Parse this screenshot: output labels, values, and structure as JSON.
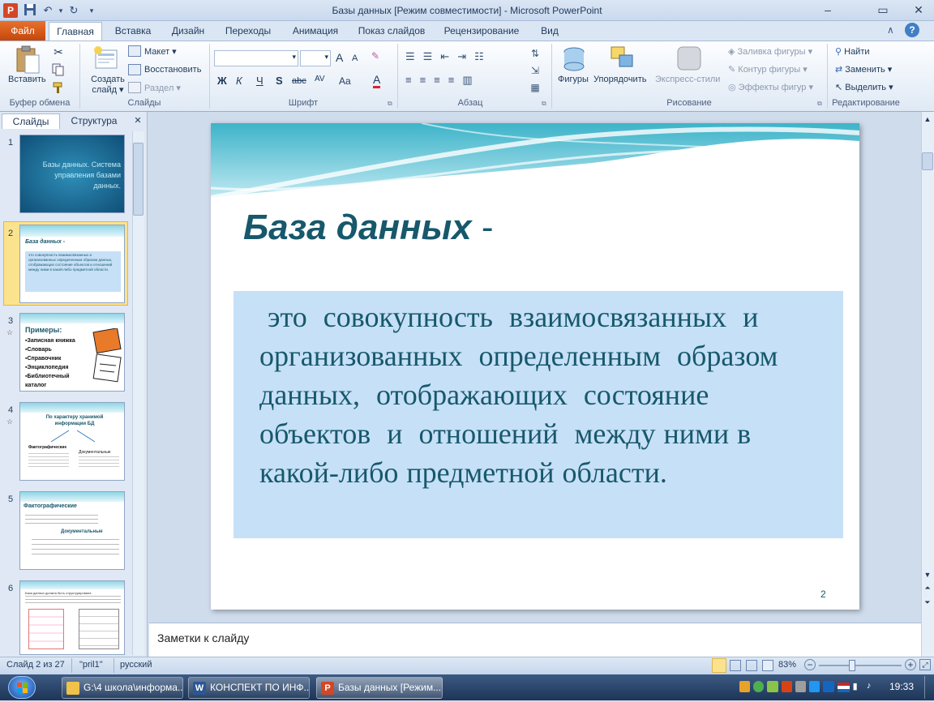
{
  "window": {
    "title": "Базы данных [Режим совместимости]  -  Microsoft PowerPoint",
    "minimize": "–",
    "maximize": "▭",
    "close": "✕"
  },
  "ribbon": {
    "file_tab": "Файл",
    "tabs": [
      "Главная",
      "Вставка",
      "Дизайн",
      "Переходы",
      "Анимация",
      "Показ слайдов",
      "Рецензирование",
      "Вид"
    ],
    "clipboard": {
      "paste": "Вставить",
      "group": "Буфер обмена"
    },
    "slides": {
      "new_slide": "Создать слайд",
      "new_slide_line1": "Создать",
      "new_slide_line2": "слайд ▾",
      "layout": "Макет ▾",
      "reset": "Восстановить",
      "section": "Раздел ▾",
      "group": "Слайды"
    },
    "font": {
      "group": "Шрифт",
      "bold": "Ж",
      "italic": "К",
      "underline": "Ч",
      "shadow": "S",
      "strike": "abc",
      "spacing": "AV",
      "case": "Aa",
      "grow": "A",
      "shrink": "A",
      "color": "A"
    },
    "paragraph": {
      "group": "Абзац"
    },
    "drawing": {
      "shapes": "Фигуры",
      "arrange": "Упорядочить",
      "quick_styles": "Экспресс-стили",
      "fill": "Заливка фигуры ▾",
      "outline": "Контур фигуры ▾",
      "effects": "Эффекты фигур ▾",
      "group": "Рисование"
    },
    "editing": {
      "find": "Найти",
      "replace": "Заменить ▾",
      "select": "Выделить ▾",
      "group": "Редактирование"
    }
  },
  "left_panel": {
    "tabs": [
      "Слайды",
      "Структура"
    ],
    "close": "✕",
    "thumbnails": [
      {
        "num": "1",
        "text": "Базы данных. Система управления базами данных."
      },
      {
        "num": "2",
        "title": "База данных -",
        "text": "это совокупность взаимосвязанных и организованных определенным образом данных, отображающих состояние объектов и отношений между ними в какой-либо предметной области."
      },
      {
        "num": "3",
        "title": "Примеры:",
        "items": [
          "Записная книжка",
          "Словарь",
          "Справочник",
          "Энциклопедия",
          "Библиотечный каталог"
        ]
      },
      {
        "num": "4",
        "title": "По характеру хранимой информации БД",
        "left": "Фактографические",
        "right": "Документальные"
      },
      {
        "num": "5",
        "title": "Фактографические",
        "sub": "Документальные"
      },
      {
        "num": "6",
        "text": "База данных должна быть структурирована"
      }
    ]
  },
  "slide": {
    "title": "База данных",
    "dash": "-",
    "body": " это  совокупность  взаимосвязанных  и  организованных  определенным  образом  данных,  отображающих  состояние  объектов  и  отношений  между ними в какой-либо предметной области.",
    "number": "2",
    "colors": {
      "title": "#17586b",
      "body": "#17586b",
      "box": "#c6e0f7",
      "wave": "#3fb6cc"
    }
  },
  "notes": {
    "placeholder": "Заметки к слайду"
  },
  "status": {
    "slide_info": "Слайд 2 из 27",
    "theme": "\"pril1\"",
    "language": "русский",
    "zoom": "83%",
    "zoom_value": 0.83
  },
  "taskbar": {
    "items": [
      {
        "label": "G:\\4 школа\\информа...",
        "icon": "folder-icon"
      },
      {
        "label": "КОНСПЕКТ ПО ИНФ...",
        "icon": "word-icon"
      },
      {
        "label": "Базы данных [Режим...",
        "icon": "powerpoint-icon"
      }
    ],
    "clock": "19:33"
  }
}
